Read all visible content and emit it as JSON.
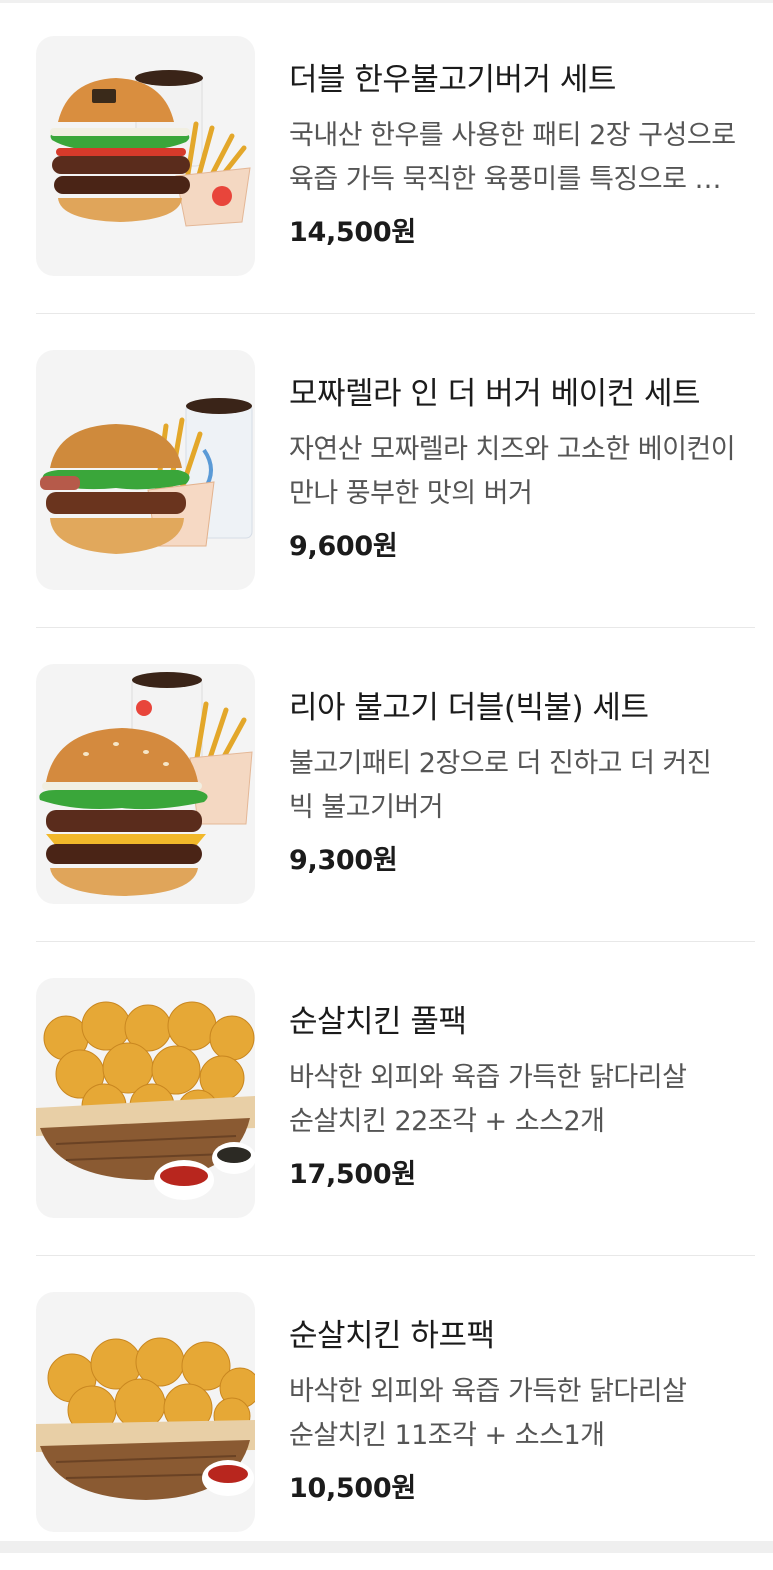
{
  "menu_items": [
    {
      "name": "더블 한우불고기버거 세트",
      "description": "국내산 한우를 사용한 패티 2장 구성으로 육즙 가득 묵직한 육풍미를 특징으로 한 버거",
      "price": "14,500원",
      "image": "burger-set"
    },
    {
      "name": "모짜렐라 인 더 버거 베이컨 세트",
      "description": "자연산 모짜렐라 치즈와 고소한 베이컨이 만나 풍부한 맛의 버거",
      "price": "9,600원",
      "image": "burger-set"
    },
    {
      "name": "리아 불고기 더블(빅불) 세트",
      "description": "불고기패티 2장으로 더 진하고 더 커진 빅 불고기버거",
      "price": "9,300원",
      "image": "burger-set"
    },
    {
      "name": "순살치킨 풀팩",
      "description": "바삭한 외피와 육즙 가득한 닭다리살 순살치킨 22조각 + 소스2개",
      "price": "17,500원",
      "image": "chicken-basket"
    },
    {
      "name": "순살치킨 하프팩",
      "description": "바삭한 외피와 육즙 가득한 닭다리살 순살치킨 11조각 + 소스1개",
      "price": "10,500원",
      "image": "chicken-basket"
    }
  ]
}
